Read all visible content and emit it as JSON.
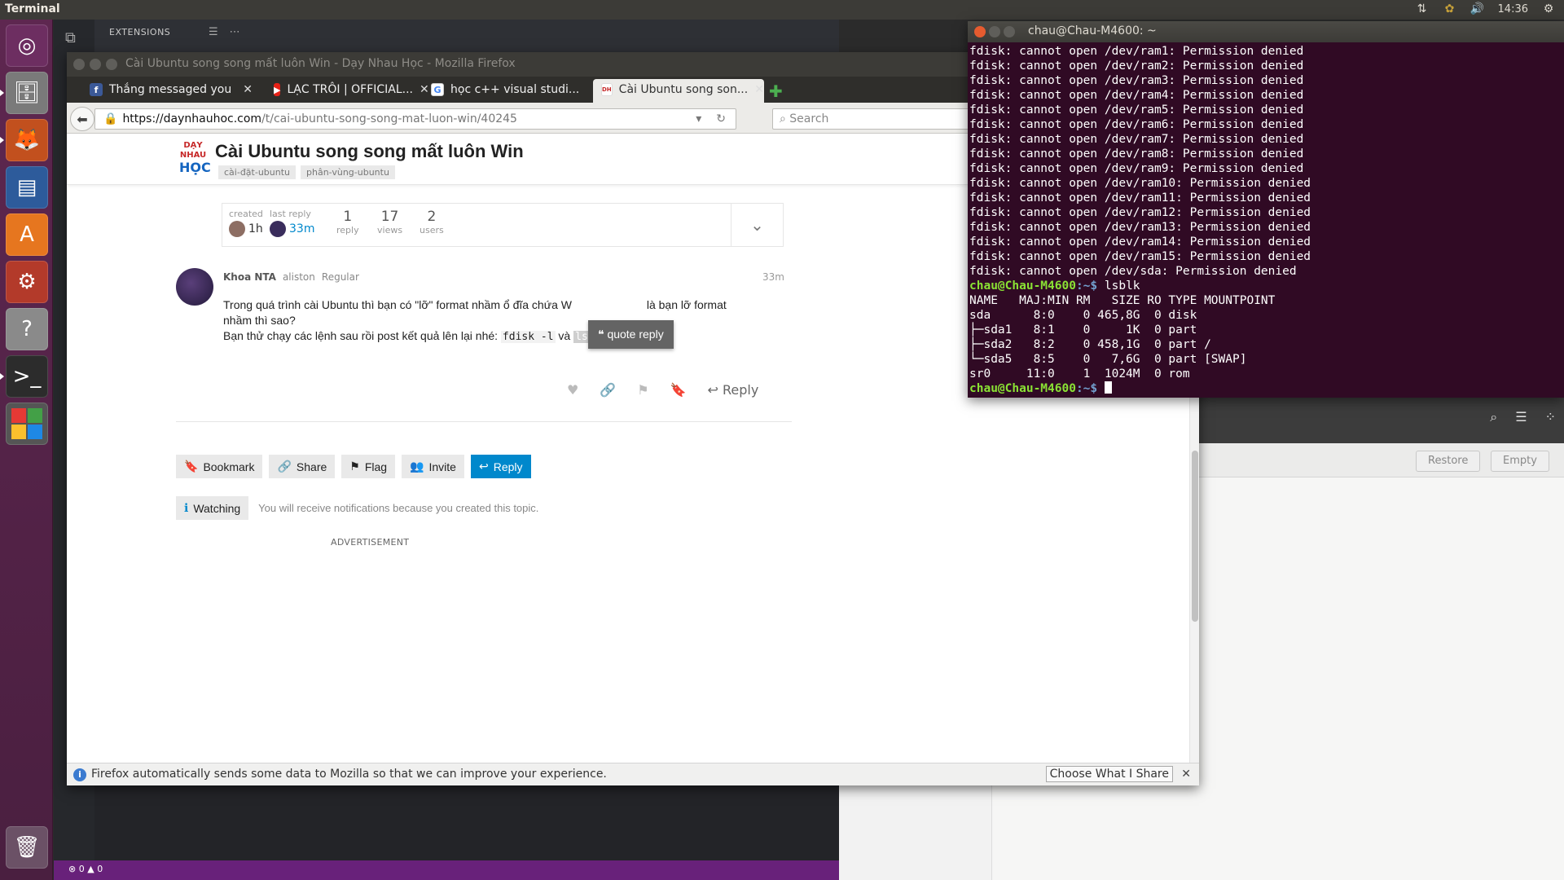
{
  "top_panel": {
    "app_title": "Terminal",
    "clock": "14:36"
  },
  "launcher": {
    "items": [
      "ubuntu-dash",
      "files",
      "firefox",
      "libreoffice-writer",
      "software-center",
      "system-settings",
      "help",
      "terminal",
      "workspaces",
      "trash"
    ]
  },
  "editor": {
    "extensions_label": "EXTENSIONS",
    "status_errors": "0",
    "status_warnings": "0"
  },
  "background_window": {
    "restore_label": "Restore",
    "empty_label": "Empty"
  },
  "firefox": {
    "window_title": "Cài Ubuntu song song mất luôn Win - Dạy Nhau Học - Mozilla Firefox",
    "tabs": [
      {
        "label": "Thắng messaged you",
        "favicon": "f",
        "color": "#3b5998"
      },
      {
        "label": "LẠC TRÔI | OFFICIAL...",
        "favicon": "▶",
        "color": "#e62117"
      },
      {
        "label": "học c++ visual studi...",
        "favicon": "G",
        "color": "#4285f4"
      },
      {
        "label": "Cài Ubuntu song son...",
        "favicon": "D",
        "color": "#1565c0"
      }
    ],
    "url_host": "https://daynhauhoc.com",
    "url_path": "/t/cai-ubuntu-song-song-mat-luon-win/40245",
    "search_placeholder": "Search",
    "notification": "Firefox automatically sends some data to Mozilla so that we can improve your experience.",
    "choose_label": "Choose What I Share"
  },
  "topic": {
    "logo_top": "DẠY",
    "logo_mid": "NHAU",
    "logo_bottom": "HỌC",
    "title": "Cài Ubuntu song song mất luôn Win",
    "tags": [
      "cài-đặt-ubuntu",
      "phân-vùng-ubuntu"
    ],
    "created_label": "created",
    "created_value": "1h",
    "last_reply_label": "last reply",
    "last_reply_value": "33m",
    "replies_num": "1",
    "replies_label": "reply",
    "views_num": "17",
    "views_label": "views",
    "users_num": "2",
    "users_label": "users"
  },
  "post": {
    "author": "Khoa NTA",
    "username": "aliston",
    "role": "Regular",
    "time": "33m",
    "line1_a": "Trong quá trình cài Ubuntu thì bạn có \"lỡ\" format nhầm ổ đĩa chứa W",
    "line1_b": " là bạn lỡ format",
    "line2": "nhầm thì sao?",
    "line3_a": "Bạn thử chạy các lệnh sau rồi post kết quả lên lại nhé: ",
    "cmd1": "fdisk -l",
    "line3_and": " và ",
    "cmd2": "lsblk",
    "quote_reply": "quote reply",
    "reply_label": "Reply"
  },
  "buttons": {
    "bookmark": "Bookmark",
    "share": "Share",
    "flag": "Flag",
    "invite": "Invite",
    "reply": "Reply",
    "watching": "Watching",
    "watching_note": "You will receive notifications because you created this topic.",
    "advertisement": "ADVERTISEMENT"
  },
  "terminal": {
    "title": "chau@Chau-M4600: ~",
    "denied_lines": [
      "fdisk: cannot open /dev/ram1: Permission denied",
      "fdisk: cannot open /dev/ram2: Permission denied",
      "fdisk: cannot open /dev/ram3: Permission denied",
      "fdisk: cannot open /dev/ram4: Permission denied",
      "fdisk: cannot open /dev/ram5: Permission denied",
      "fdisk: cannot open /dev/ram6: Permission denied",
      "fdisk: cannot open /dev/ram7: Permission denied",
      "fdisk: cannot open /dev/ram8: Permission denied",
      "fdisk: cannot open /dev/ram9: Permission denied",
      "fdisk: cannot open /dev/ram10: Permission denied",
      "fdisk: cannot open /dev/ram11: Permission denied",
      "fdisk: cannot open /dev/ram12: Permission denied",
      "fdisk: cannot open /dev/ram13: Permission denied",
      "fdisk: cannot open /dev/ram14: Permission denied",
      "fdisk: cannot open /dev/ram15: Permission denied",
      "fdisk: cannot open /dev/sda: Permission denied"
    ],
    "prompt_user": "chau@Chau-M4600",
    "prompt_path": ":~$",
    "command": " lsblk",
    "lsblk_lines": [
      "NAME   MAJ:MIN RM   SIZE RO TYPE MOUNTPOINT",
      "sda      8:0    0 465,8G  0 disk ",
      "├─sda1   8:1    0     1K  0 part ",
      "├─sda2   8:2    0 458,1G  0 part /",
      "└─sda5   8:5    0   7,6G  0 part [SWAP]",
      "sr0     11:0    1  1024M  0 rom  "
    ]
  }
}
